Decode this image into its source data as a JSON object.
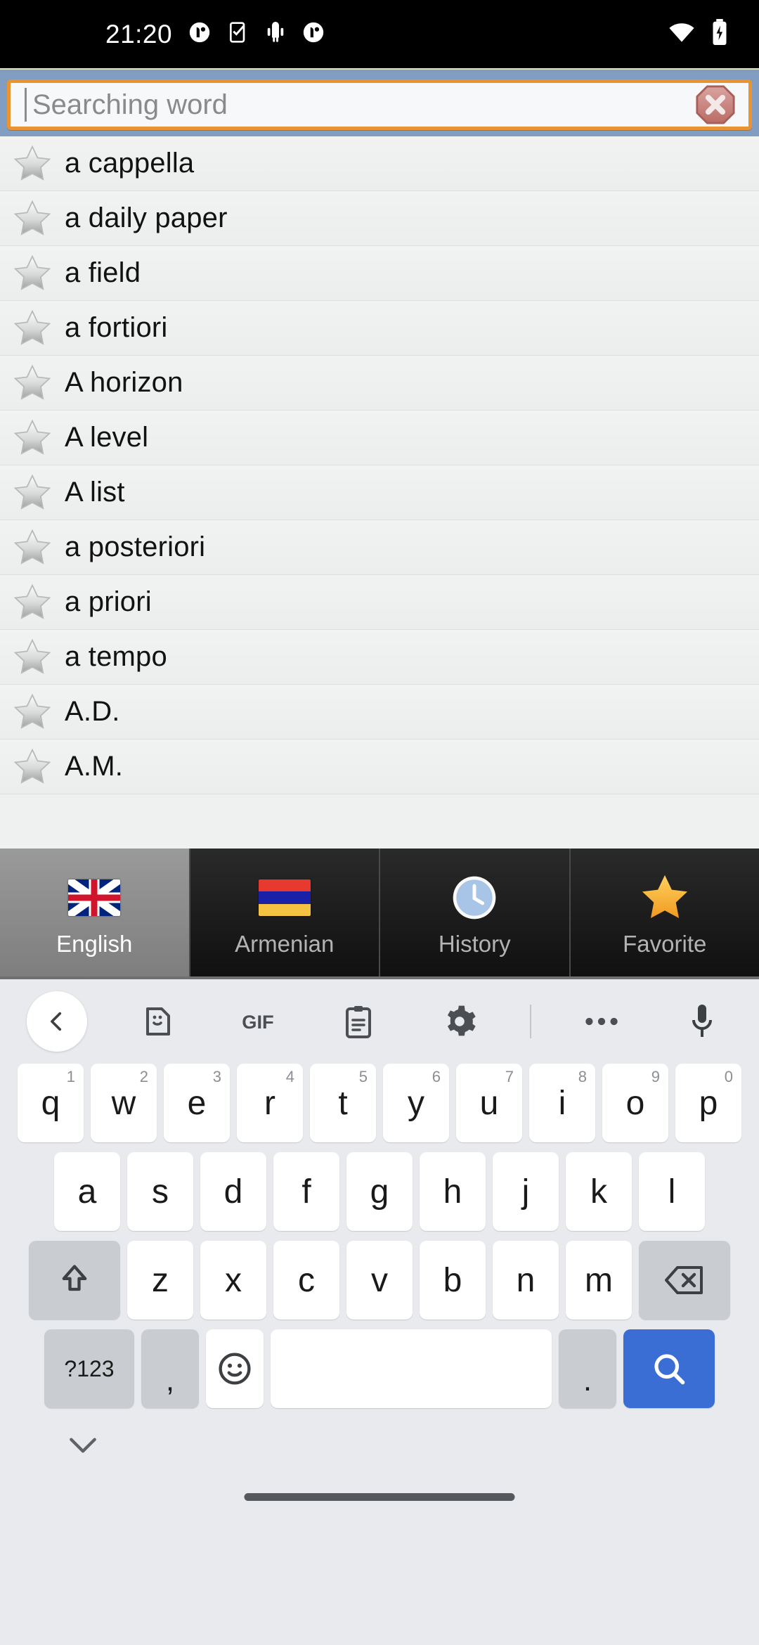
{
  "status_bar": {
    "time": "21:20",
    "left_icons": [
      "app-notification-icon",
      "task-check-icon",
      "android-robot-icon",
      "app-notification-icon-2"
    ],
    "right_icons": [
      "wifi-icon",
      "battery-charging-icon"
    ]
  },
  "search": {
    "placeholder": "Searching word",
    "value": "",
    "clear_icon": "clear-octagon-x-icon",
    "border_color": "#e89434",
    "header_color": "#829dc2"
  },
  "word_list": {
    "star_icon": "favorite-star-outline-icon",
    "items": [
      {
        "word": "a cappella"
      },
      {
        "word": "a daily paper"
      },
      {
        "word": "a field"
      },
      {
        "word": "a fortiori"
      },
      {
        "word": "A horizon"
      },
      {
        "word": "A level"
      },
      {
        "word": "A list"
      },
      {
        "word": "a posteriori"
      },
      {
        "word": "a priori"
      },
      {
        "word": "a tempo"
      },
      {
        "word": "A.D."
      },
      {
        "word": "A.M."
      }
    ]
  },
  "tabs": [
    {
      "label": "English",
      "icon": "uk-flag-icon",
      "active": true
    },
    {
      "label": "Armenian",
      "icon": "armenia-flag-icon",
      "active": false
    },
    {
      "label": "History",
      "icon": "clock-icon",
      "active": false
    },
    {
      "label": "Favorite",
      "icon": "gold-star-icon",
      "active": false
    }
  ],
  "keyboard": {
    "toolbar": [
      {
        "name": "back-chevron-icon",
        "label": ""
      },
      {
        "name": "sticker-icon",
        "label": ""
      },
      {
        "name": "gif-icon",
        "label": "GIF"
      },
      {
        "name": "clipboard-icon",
        "label": ""
      },
      {
        "name": "gear-icon",
        "label": ""
      },
      {
        "name": "overflow-dots-icon",
        "label": ""
      },
      {
        "name": "microphone-icon",
        "label": ""
      }
    ],
    "row1": [
      {
        "key": "q",
        "num": "1"
      },
      {
        "key": "w",
        "num": "2"
      },
      {
        "key": "e",
        "num": "3"
      },
      {
        "key": "r",
        "num": "4"
      },
      {
        "key": "t",
        "num": "5"
      },
      {
        "key": "y",
        "num": "6"
      },
      {
        "key": "u",
        "num": "7"
      },
      {
        "key": "i",
        "num": "8"
      },
      {
        "key": "o",
        "num": "9"
      },
      {
        "key": "p",
        "num": "0"
      }
    ],
    "row2": [
      {
        "key": "a"
      },
      {
        "key": "s"
      },
      {
        "key": "d"
      },
      {
        "key": "f"
      },
      {
        "key": "g"
      },
      {
        "key": "h"
      },
      {
        "key": "j"
      },
      {
        "key": "k"
      },
      {
        "key": "l"
      }
    ],
    "row3": [
      {
        "key": "z"
      },
      {
        "key": "x"
      },
      {
        "key": "c"
      },
      {
        "key": "v"
      },
      {
        "key": "b"
      },
      {
        "key": "n"
      },
      {
        "key": "m"
      }
    ],
    "shift_icon": "shift-arrow-icon",
    "backspace_icon": "backspace-icon",
    "symbols_label": "?123",
    "comma_label": ",",
    "emoji_icon": "emoji-smiley-icon",
    "space_label": "",
    "period_label": ".",
    "enter_icon": "search-magnifier-icon",
    "enter_color": "#3a6ed4",
    "hide_keyboard_icon": "chevron-down-icon"
  }
}
